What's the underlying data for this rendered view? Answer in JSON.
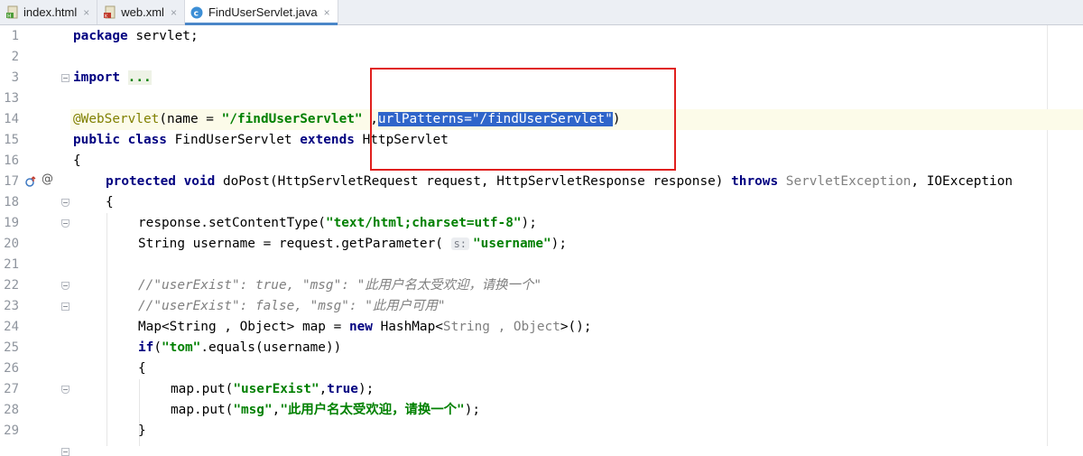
{
  "tabs": [
    {
      "label": "index.html",
      "icon": "html-file-icon",
      "active": false
    },
    {
      "label": "web.xml",
      "icon": "xml-file-icon",
      "active": false
    },
    {
      "label": "FindUserServlet.java",
      "icon": "java-class-icon",
      "active": true
    }
  ],
  "tab_close_glyph": "×",
  "line_numbers": [
    "1",
    "2",
    "3",
    "13",
    "14",
    "15",
    "16",
    "17",
    "18",
    "19",
    "20",
    "21",
    "22",
    "23",
    "24",
    "25",
    "26",
    "27",
    "28",
    "29"
  ],
  "code": {
    "l1": {
      "kw": "package",
      "rest": " servlet;"
    },
    "l3": {
      "kw": "import",
      "sp": " ",
      "folded": "..."
    },
    "l14": {
      "ann": "@WebServlet",
      "a": "(name = ",
      "s1": "\"/findUserServlet\"",
      "b": " ,",
      "sel": "urlPatterns=\"/findUserServlet\"",
      "c": ")"
    },
    "l15": {
      "kw1": "public class",
      "a": " FindUserServlet ",
      "kw2": "extends",
      "b": " HttpServlet"
    },
    "l16": "{",
    "l17": {
      "kw1": "protected void",
      "a": " doPost(HttpServletRequest request, HttpServletResponse response) ",
      "kw2": "throws",
      "sp": " ",
      "g": "ServletException",
      "b": ", IOException"
    },
    "l18": "{",
    "l19": {
      "a": "response.setContentType(",
      "s": "\"text/html;charset=utf-8\"",
      "b": ");"
    },
    "l20": {
      "a": "String username = request.getParameter( ",
      "hint": "s:",
      "s": "\"username\"",
      "b": ");"
    },
    "l22": "//\"userExist\": true, \"msg\": \"此用户名太受欢迎，请换一个\"",
    "l23": "//\"userExist\": false, \"msg\": \"此用户可用\"",
    "l24": {
      "a": "Map<String , Object> map = ",
      "kw": "new",
      "b": " HashMap<",
      "g": "String , Object",
      "c": ">();"
    },
    "l25": {
      "kw": "if",
      "a": "(",
      "s": "\"tom\"",
      "b": ".equals(username))"
    },
    "l26": "{",
    "l27": {
      "a": "map.put(",
      "s": "\"userExist\"",
      "b": ",",
      "kw": "true",
      "c": ");"
    },
    "l28": {
      "a": "map.put(",
      "s1": "\"msg\"",
      "b": ",",
      "s2": "\"此用户名太受欢迎，请换一个\"",
      "c": ");"
    },
    "l29": "}"
  },
  "gutter_icons": {
    "override": "override-method-icon",
    "annotation": "@"
  },
  "colors": {
    "keyword": "#000080",
    "string": "#008000",
    "annotation": "#808000",
    "comment": "#808080",
    "selection": "#2f65ca",
    "highlight_box": "#e0201e"
  }
}
